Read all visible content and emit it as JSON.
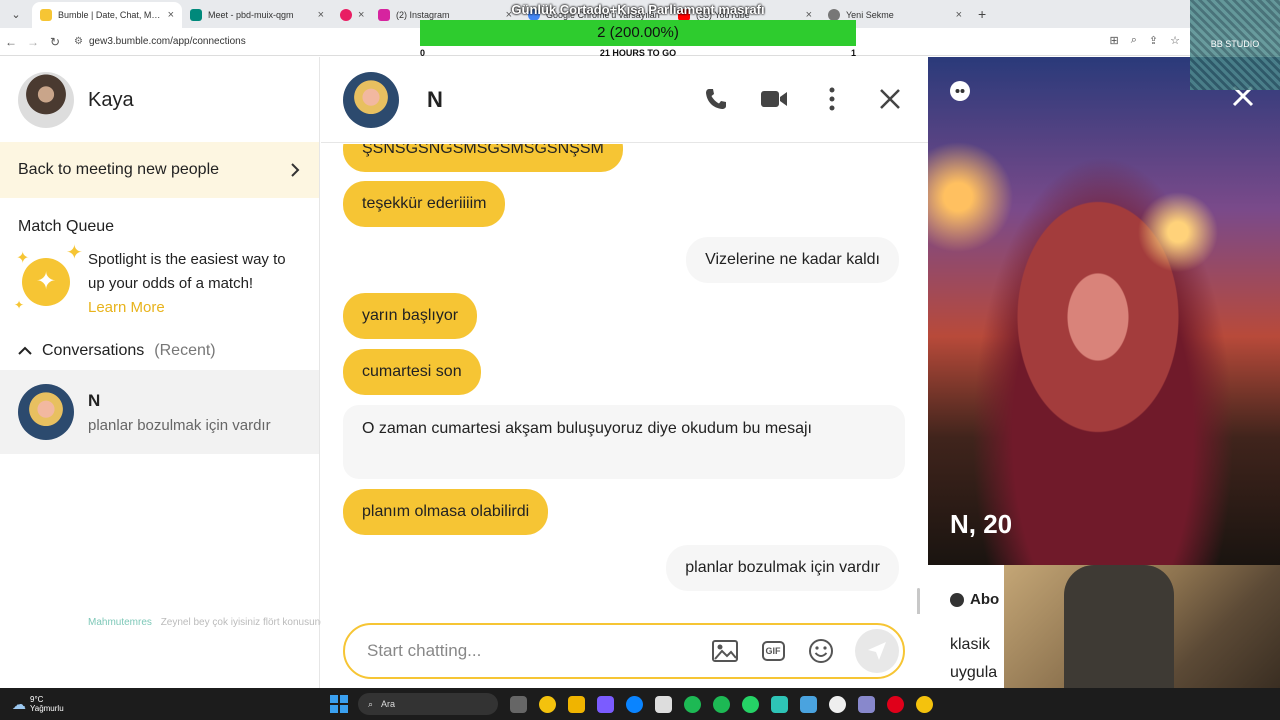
{
  "browser": {
    "tabs": [
      {
        "label": "Bumble | Date, Chat, Meet New",
        "favicon_color": "#f6c534",
        "active": true
      },
      {
        "label": "Meet - pbd-muix-qgm",
        "favicon_color": "#00897b",
        "active": false
      },
      {
        "label": "",
        "favicon_color": "#e91e63",
        "active": false
      },
      {
        "label": "(2) Instagram",
        "favicon_color": "#d6249f",
        "active": false
      },
      {
        "label": "Google Chrome'u varsayılan",
        "favicon_color": "#4285f4",
        "active": false
      },
      {
        "label": "(33) YouTube",
        "favicon_color": "#ff0000",
        "active": false
      },
      {
        "label": "Yeni Sekme",
        "favicon_color": "#777777",
        "active": false
      }
    ],
    "url": "gew3.bumble.com/app/connections"
  },
  "stream_overlay": {
    "title": "Günlük Cortado+Kısa Parliament masrafı",
    "progress_text": "2 (200.00%)",
    "progress_fraction": 1.0,
    "left_value": "0",
    "caption": "21 HOURS TO GO",
    "right_value": "1",
    "studio_label": "BB STUDIO"
  },
  "sidebar": {
    "user_name": "Kaya",
    "back_label": "Back to meeting new people",
    "queue_title": "Match Queue",
    "spotlight_text": "Spotlight is the easiest way to up your odds of a match!",
    "learn_more": "Learn More",
    "conversations_label": "Conversations",
    "conversations_sub": "(Recent)",
    "conversation": {
      "name": "N",
      "preview": "planlar bozulmak için vardır"
    },
    "ticker_user": "Mahmutemres",
    "ticker_text": "Zeynel bey çok iyisiniz flört konusunda"
  },
  "chat": {
    "contact_name": "N",
    "messages": [
      {
        "side": "in",
        "text": "ŞSNSĞSNĞSMSĞSMSĞSNŞSM"
      },
      {
        "side": "in",
        "text": "teşekkür ederiiiim"
      },
      {
        "side": "out",
        "text": "Vizelerine ne kadar kaldı"
      },
      {
        "side": "in",
        "text": "yarın başlıyor"
      },
      {
        "side": "in",
        "text": "cumartesi son"
      },
      {
        "side": "out",
        "text": "O zaman cumartesi akşam buluşuyoruz diye okudum bu mesajı"
      },
      {
        "side": "in",
        "text": "planım olmasa olabilirdi"
      },
      {
        "side": "out",
        "text": "planlar bozulmak için vardır"
      }
    ],
    "composer_placeholder": "Start chatting...",
    "gif_label": "GIF"
  },
  "profile": {
    "name_age": "N, 20",
    "about_label": "Abo",
    "about_text_1": "klasik",
    "about_text_2": "uygula"
  },
  "taskbar": {
    "temperature": "9°C",
    "weather": "Yağmurlu",
    "search_label": "Ara"
  },
  "colors": {
    "accent": "#f6c534",
    "progress": "#2ecc2e"
  }
}
